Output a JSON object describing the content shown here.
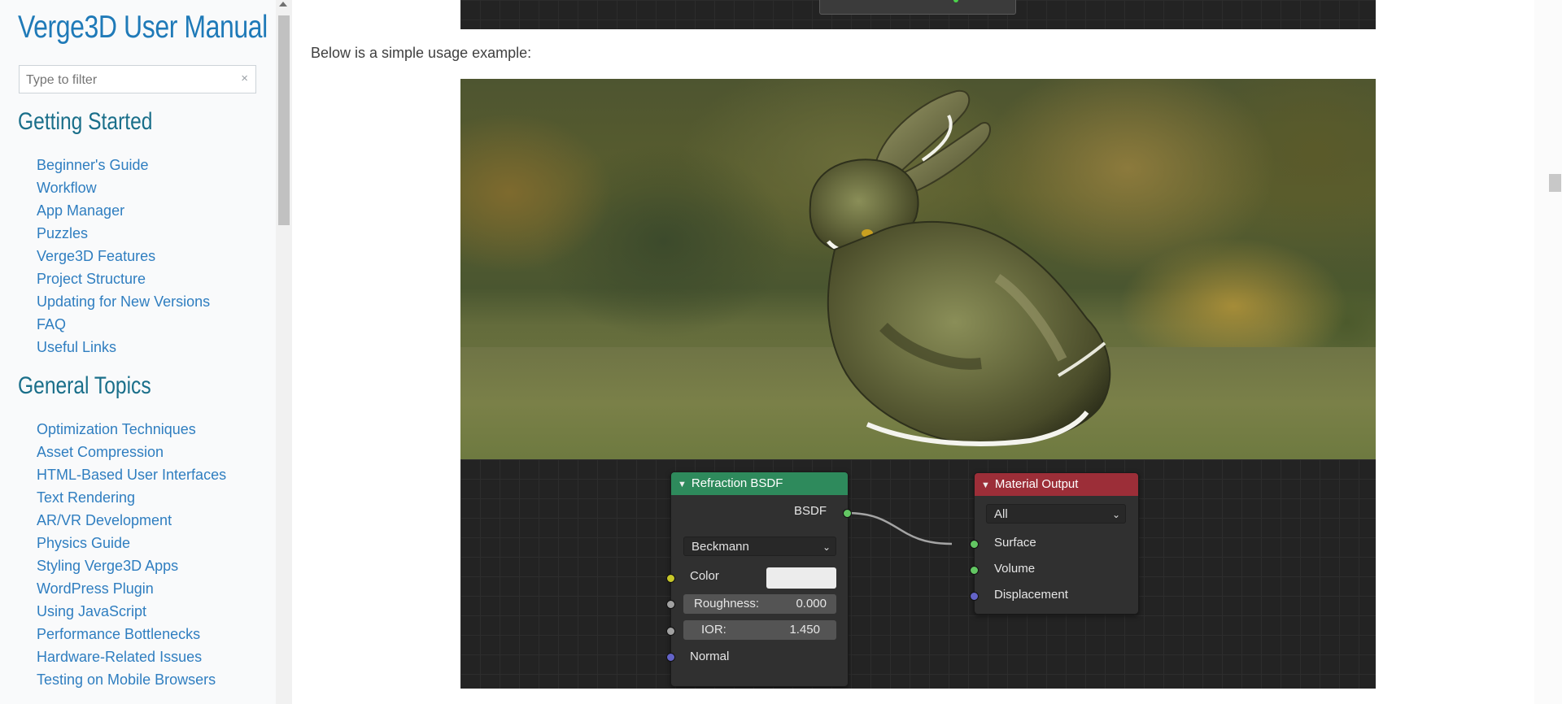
{
  "sidebar": {
    "site_title": "Verge3D User Manual",
    "filter": {
      "placeholder": "Type to filter",
      "clear_glyph": "×"
    },
    "sections": [
      {
        "title": "Getting Started",
        "items": [
          "Beginner's Guide",
          "Workflow",
          "App Manager",
          "Puzzles",
          "Verge3D Features",
          "Project Structure",
          "Updating for New Versions",
          "FAQ",
          "Useful Links"
        ]
      },
      {
        "title": "General Topics",
        "items": [
          "Optimization Techniques",
          "Asset Compression",
          "HTML-Based User Interfaces",
          "Text Rendering",
          "AR/VR Development",
          "Physics Guide",
          "Styling Verge3D Apps",
          "WordPress Plugin",
          "Using JavaScript",
          "Performance Bottlenecks",
          "Hardware-Related Issues",
          "Testing on Mobile Browsers"
        ]
      }
    ]
  },
  "main": {
    "intro_text": "Below is a simple usage example:",
    "render_image_subject": "glass-bunny-render"
  },
  "node_editor": {
    "refraction_node": {
      "title": "Refraction BSDF",
      "header_color": "#2e8a5c",
      "output_label": "BSDF",
      "distribution": "Beckmann",
      "color_label": "Color",
      "roughness_label": "Roughness:",
      "roughness_value": "0.000",
      "ior_label": "IOR:",
      "ior_value": "1.450",
      "normal_label": "Normal"
    },
    "material_output_node": {
      "title": "Material Output",
      "header_color": "#9c2e38",
      "target": "All",
      "inputs": [
        "Surface",
        "Volume",
        "Displacement"
      ]
    }
  },
  "colors": {
    "link_blue": "#2f7ec0",
    "title_blue": "#1f7ab8",
    "section_teal": "#1a6f8a"
  }
}
